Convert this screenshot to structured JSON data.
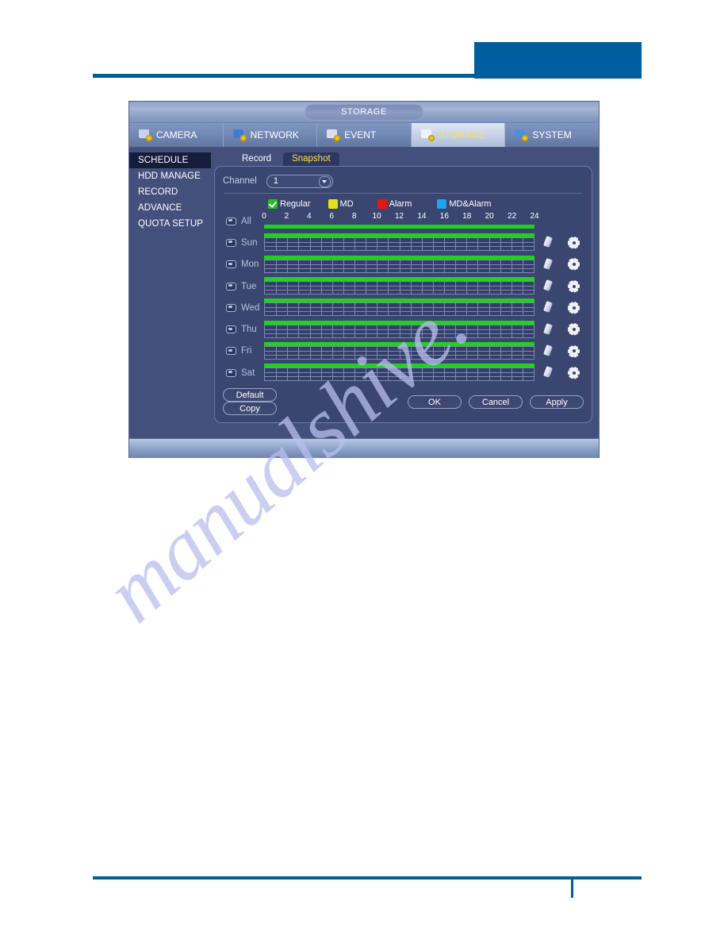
{
  "window": {
    "title": "STORAGE"
  },
  "main_tabs": [
    {
      "label": "CAMERA",
      "icon": "camera-icon",
      "active": false,
      "icon_color": "#c9d4ea"
    },
    {
      "label": "NETWORK",
      "icon": "network-icon",
      "active": false,
      "icon_color": "#3d7fd4"
    },
    {
      "label": "EVENT",
      "icon": "event-icon",
      "active": false,
      "icon_color": "#d8dfef"
    },
    {
      "label": "STORAGE",
      "icon": "storage-icon",
      "active": true,
      "icon_color": "#eef2fa"
    },
    {
      "label": "SYSTEM",
      "icon": "system-icon",
      "active": false,
      "icon_color": "#4f8ddd"
    }
  ],
  "sidebar": {
    "items": [
      {
        "label": "SCHEDULE",
        "active": true
      },
      {
        "label": "HDD MANAGE",
        "active": false
      },
      {
        "label": "RECORD",
        "active": false
      },
      {
        "label": "ADVANCE",
        "active": false
      },
      {
        "label": "QUOTA SETUP",
        "active": false
      }
    ]
  },
  "sub_tabs": [
    {
      "label": "Record",
      "active": false
    },
    {
      "label": "Snapshot",
      "active": true
    }
  ],
  "channel": {
    "label": "Channel",
    "value": "1",
    "options": [
      "1"
    ]
  },
  "legend": [
    {
      "label": "Regular",
      "color": "#22c222",
      "checked": true
    },
    {
      "label": "MD",
      "color": "#e2e21c",
      "checked": false
    },
    {
      "label": "Alarm",
      "color": "#e81414",
      "checked": false
    },
    {
      "label": "MD&Alarm",
      "color": "#1fa4ef",
      "checked": false
    }
  ],
  "hour_ticks": [
    "0",
    "2",
    "4",
    "6",
    "8",
    "10",
    "12",
    "14",
    "16",
    "18",
    "20",
    "22",
    "24"
  ],
  "rows": [
    {
      "label": "All",
      "checked": false,
      "ruler": true,
      "bar_color": "#22d11f"
    },
    {
      "label": "Sun",
      "checked": false,
      "ruler": false,
      "bar_color": "#22d11f"
    },
    {
      "label": "Mon",
      "checked": false,
      "ruler": false,
      "bar_color": "#22d11f"
    },
    {
      "label": "Tue",
      "checked": false,
      "ruler": false,
      "bar_color": "#22d11f"
    },
    {
      "label": "Wed",
      "checked": false,
      "ruler": false,
      "bar_color": "#22d11f"
    },
    {
      "label": "Thu",
      "checked": false,
      "ruler": false,
      "bar_color": "#22d11f"
    },
    {
      "label": "Fri",
      "checked": false,
      "ruler": false,
      "bar_color": "#22d11f"
    },
    {
      "label": "Sat",
      "checked": false,
      "ruler": false,
      "bar_color": "#22d11f"
    }
  ],
  "buttons": {
    "left": [
      "Default",
      "Copy"
    ],
    "right": [
      "OK",
      "Cancel",
      "Apply"
    ]
  },
  "watermark": {
    "text": "manualshive."
  },
  "colors": {
    "accent_blue": "#005e9e",
    "window_bg": "#44507c",
    "panel_bg": "#3b4670",
    "active_tab_text": "#ffe14d",
    "bar_green": "#22d11f"
  }
}
